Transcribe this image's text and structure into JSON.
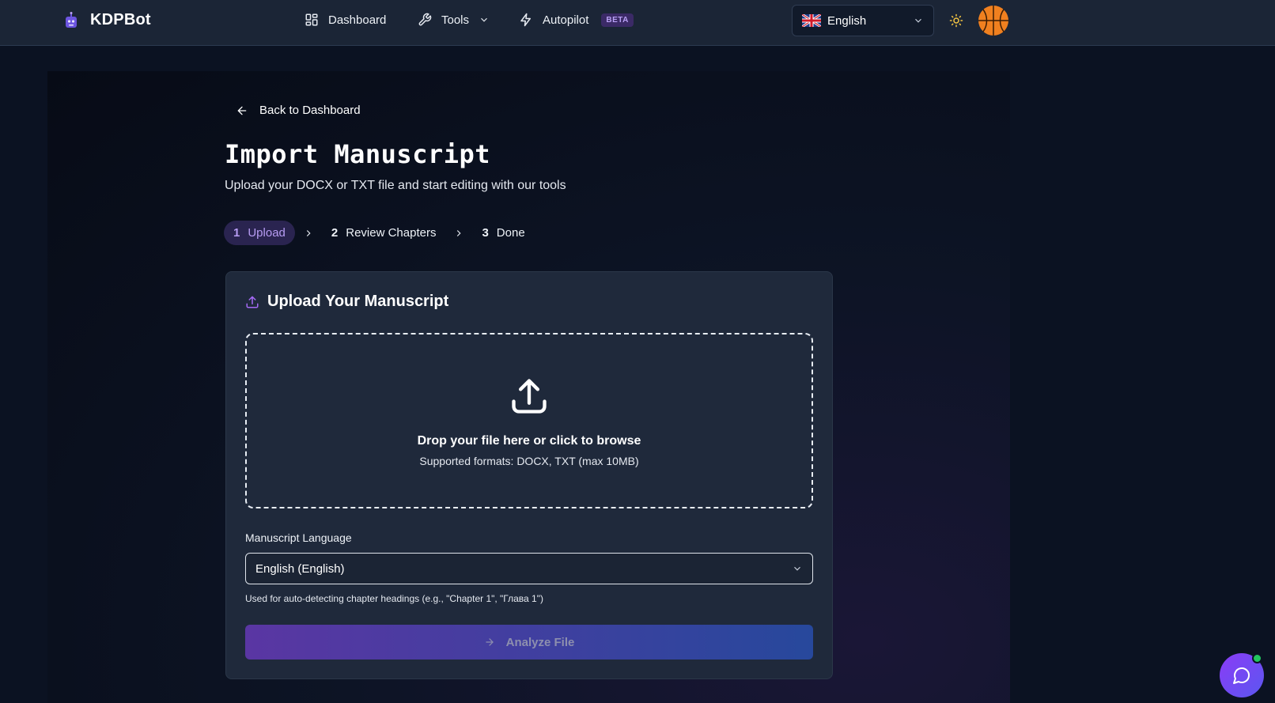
{
  "header": {
    "brand": "KDPBot",
    "nav": {
      "dashboard": "Dashboard",
      "tools": "Tools",
      "autopilot": "Autopilot",
      "autopilot_badge": "BETA"
    },
    "language": "English",
    "icons": {
      "dashboard": "grid-icon",
      "tools": "wrench-icon",
      "autopilot": "lightning-icon",
      "theme": "sun-icon",
      "avatar": "basketball-avatar"
    }
  },
  "page": {
    "back_label": "Back to Dashboard",
    "title": "Import Manuscript",
    "subtitle": "Upload your DOCX or TXT file and start editing with our tools"
  },
  "steps": [
    {
      "num": "1",
      "label": "Upload",
      "active": true
    },
    {
      "num": "2",
      "label": "Review Chapters",
      "active": false
    },
    {
      "num": "3",
      "label": "Done",
      "active": false
    }
  ],
  "upload_card": {
    "title": "Upload Your Manuscript",
    "drop_title": "Drop your file here or click to browse",
    "drop_sub": "Supported formats: DOCX, TXT (max 10MB)",
    "language_label": "Manuscript Language",
    "language_value": "English (English)",
    "language_hint": "Used for auto-detecting chapter headings (e.g., \"Chapter 1\", \"Глава 1\")",
    "analyze_label": "Analyze File"
  },
  "colors": {
    "accent": "#8b5cf6",
    "background": "#0b1222",
    "card": "#1f293b",
    "online": "#22c55e"
  }
}
